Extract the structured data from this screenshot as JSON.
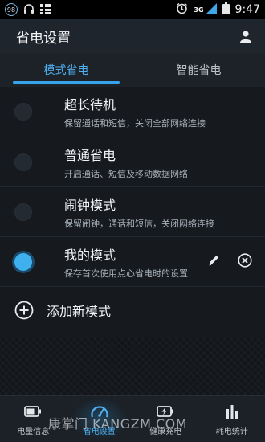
{
  "status_bar": {
    "badge_text": "98",
    "network_label": "3G",
    "time": "9:47"
  },
  "header": {
    "title": "省电设置"
  },
  "tabs": [
    {
      "label": "模式省电",
      "active": true
    },
    {
      "label": "智能省电",
      "active": false
    }
  ],
  "modes": [
    {
      "name": "超长待机",
      "desc": "保留通话和短信，关闭全部网络连接",
      "selected": false
    },
    {
      "name": "普通省电",
      "desc": "开启通话、短信及移动数据网络",
      "selected": false
    },
    {
      "name": "闹钟模式",
      "desc": "保留闹钟，通话和短信，关闭网络连接",
      "selected": false
    },
    {
      "name": "我的模式",
      "desc": "保存首次使用点心省电时的设置",
      "selected": true
    }
  ],
  "add_mode": {
    "label": "添加新模式"
  },
  "bottom_nav": [
    {
      "label": "电量信息",
      "icon": "battery-icon",
      "active": false
    },
    {
      "label": "省电设置",
      "icon": "speedometer-icon",
      "active": true
    },
    {
      "label": "健康充电",
      "icon": "charging-battery-icon",
      "active": false
    },
    {
      "label": "耗电统计",
      "icon": "bar-chart-icon",
      "active": false
    }
  ],
  "watermark": "康掌门 KANGZM.COM",
  "colors": {
    "accent": "#35a4ec",
    "background": "#161a1f",
    "header": "#1e252c"
  }
}
